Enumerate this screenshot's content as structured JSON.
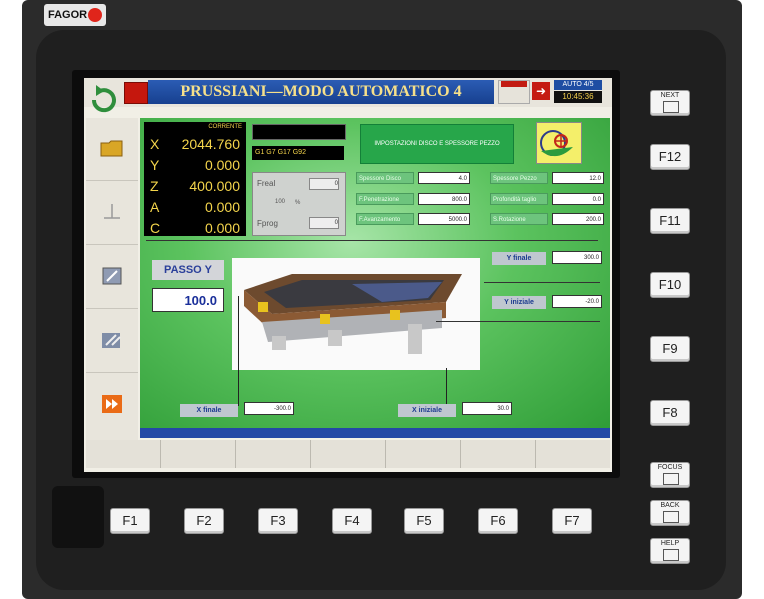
{
  "brand": {
    "logo_text": "FAGOR"
  },
  "header": {
    "title": "PRUSSIANI—MODO AUTOMATICO 4",
    "mode": "AUTO 4/5",
    "time": "10:45:36"
  },
  "dro": {
    "header": "CORRENTE",
    "axes": [
      {
        "name": "X",
        "value": "2044.760"
      },
      {
        "name": "Y",
        "value": "0.000"
      },
      {
        "name": "Z",
        "value": "400.000"
      },
      {
        "name": "A",
        "value": "0.000"
      },
      {
        "name": "C",
        "value": "0.000"
      }
    ]
  },
  "gcodes": "G1 G7 G17 G92",
  "feed": {
    "freal_label": "Freal",
    "freal_value": "0",
    "percent_value": "100",
    "percent_unit": "%",
    "fprog_label": "Fprog",
    "fprog_value": "0"
  },
  "settings": {
    "title": "IMPOSTAZIONI DISCO E SPESSORE PEZZO",
    "left": [
      {
        "label": "Spessore Disco",
        "value": "4.0"
      },
      {
        "label": "F.Penetrazione",
        "value": "800.0"
      },
      {
        "label": "F.Avanzamento",
        "value": "5000.0"
      }
    ],
    "right": [
      {
        "label": "Spessore Pezzo",
        "value": "12.0"
      },
      {
        "label": "Profondità taglio",
        "value": "0.0"
      },
      {
        "label": "S.Rotazione",
        "value": "200.0"
      }
    ]
  },
  "passo": {
    "label": "PASSO Y",
    "value": "100.0"
  },
  "coords": {
    "y_finale_label": "Y finale",
    "y_finale_value": "300.0",
    "y_iniziale_label": "Y iniziale",
    "y_iniziale_value": "-20.0",
    "x_finale_label": "X finale",
    "x_finale_value": "-300.0",
    "x_iniziale_label": "X iniziale",
    "x_iniziale_value": "30.0"
  },
  "fkeys": [
    "F1",
    "F2",
    "F3",
    "F4",
    "F5",
    "F6",
    "F7"
  ],
  "rkeys": [
    "F12",
    "F11",
    "F10",
    "F9",
    "F8"
  ],
  "special_keys": {
    "next": "NEXT",
    "focus": "FOCUS",
    "back": "BACK",
    "help": "HELP"
  },
  "colors": {
    "title_bg": "#2b5cb4",
    "title_text": "#f6e08a",
    "panel": "#5cc35f",
    "dro_text": "#f4d54c"
  }
}
